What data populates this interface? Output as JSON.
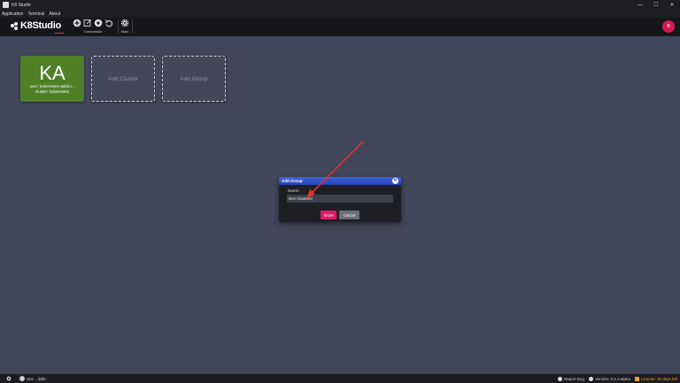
{
  "window": {
    "title": "K8 Studio",
    "controls": [
      "—",
      "☐",
      "✕"
    ]
  },
  "menu": [
    "Application",
    "Terminal",
    "About"
  ],
  "logo": {
    "text": "K8Studio"
  },
  "toolbar": {
    "commands_label": "Commands",
    "main_label": "Main"
  },
  "user": {
    "initial": "B"
  },
  "cards": {
    "cluster": {
      "abbr": "KA",
      "line1": "user: kubernetes-admin...",
      "line2": "cluster: kubernetes"
    },
    "add_cluster": "Add Cluster",
    "add_group": "Add Group"
  },
  "dialog": {
    "title": "Add Group",
    "close": "✕",
    "name_label": "Name:",
    "name_value": "Dev Clusters|",
    "done": "Done",
    "cancel": "Cancel"
  },
  "status": {
    "star": "Star",
    "star_count": "159",
    "report_bug": "Report Bug",
    "version": "Version: 0.2.2-alpha",
    "license": "License: 30 days left"
  },
  "colors": {
    "accent": "#e0196a",
    "cluster_card": "#4f7f27",
    "dialog_header": "#2746b8",
    "arrow": "#e0322b"
  }
}
